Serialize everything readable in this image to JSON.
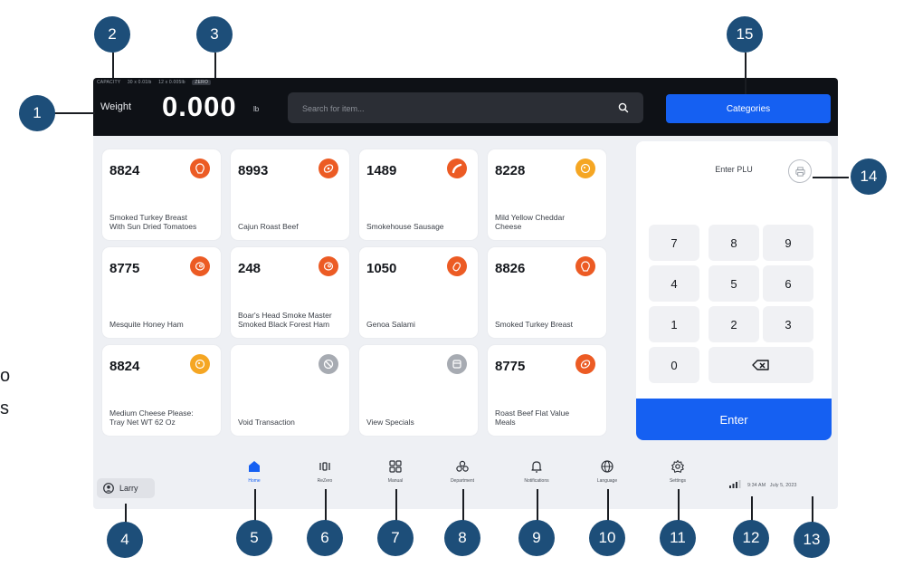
{
  "topbar": {
    "capacity_label": "CAPACITY",
    "capacity_range_1": "30 x 0.01lb",
    "capacity_range_2": "12 x 0.005lb",
    "zero_label": "ZERO",
    "weight_label": "Weight",
    "weight_value": "0.000",
    "weight_unit": "lb",
    "search_placeholder": "Search for item...",
    "categories_label": "Categories"
  },
  "products": [
    {
      "plu": "8824",
      "name": "Smoked Turkey Breast With Sun Dried Tomatoes",
      "icon": "turkey-icon",
      "color": "#ec5b24"
    },
    {
      "plu": "8993",
      "name": "Cajun Roast Beef",
      "icon": "steak-icon",
      "color": "#ec5b24"
    },
    {
      "plu": "1489",
      "name": "Smokehouse Sausage",
      "icon": "sausage-icon",
      "color": "#ec5b24"
    },
    {
      "plu": "8228",
      "name": "Mild Yellow Cheddar Cheese",
      "icon": "cheese-icon",
      "color": "#f5a623"
    },
    {
      "plu": "8775",
      "name": "Mesquite Honey Ham",
      "icon": "ham-icon",
      "color": "#ec5b24"
    },
    {
      "plu": "248",
      "name": "Boar's Head Smoke Master Smoked Black Forest Ham",
      "icon": "ham-icon",
      "color": "#ec5b24"
    },
    {
      "plu": "1050",
      "name": "Genoa Salami",
      "icon": "salami-icon",
      "color": "#ec5b24"
    },
    {
      "plu": "8826",
      "name": "Smoked Turkey Breast",
      "icon": "turkey-icon",
      "color": "#ec5b24"
    },
    {
      "plu": "8824",
      "name": "Medium Cheese Please: Tray Net WT 62 Oz",
      "icon": "cheese-icon",
      "color": "#f5a623"
    },
    {
      "plu": "",
      "name": "Void Transaction",
      "icon": "void-icon",
      "color": "#a7abb2"
    },
    {
      "plu": "",
      "name": "View Specials",
      "icon": "specials-icon",
      "color": "#a7abb2"
    },
    {
      "plu": "8775",
      "name": "Roast Beef Flat Value Meals",
      "icon": "steak-icon",
      "color": "#ec5b24"
    }
  ],
  "keypad": {
    "title": "Enter PLU",
    "keys": [
      "7",
      "8",
      "9",
      "4",
      "5",
      "6",
      "1",
      "2",
      "3",
      "0"
    ],
    "enter_label": "Enter"
  },
  "footer": {
    "user_name": "Larry",
    "nav": [
      {
        "label": "Home",
        "icon": "home-icon"
      },
      {
        "label": "ReZero",
        "icon": "rezero-icon"
      },
      {
        "label": "Manual",
        "icon": "grid-icon"
      },
      {
        "label": "Department",
        "icon": "department-icon"
      },
      {
        "label": "Notifications",
        "icon": "bell-icon"
      },
      {
        "label": "Language",
        "icon": "globe-icon"
      },
      {
        "label": "Settings",
        "icon": "gear-icon"
      }
    ],
    "time": "9:34 AM",
    "date": "July 5, 2023"
  },
  "callouts": [
    "1",
    "2",
    "3",
    "4",
    "5",
    "6",
    "7",
    "8",
    "9",
    "10",
    "11",
    "12",
    "13",
    "14",
    "15"
  ],
  "side_text": [
    "o",
    "s"
  ],
  "colors": {
    "accent": "#1560f2",
    "badge": "#1d4e79",
    "topbar": "#0e1116"
  }
}
